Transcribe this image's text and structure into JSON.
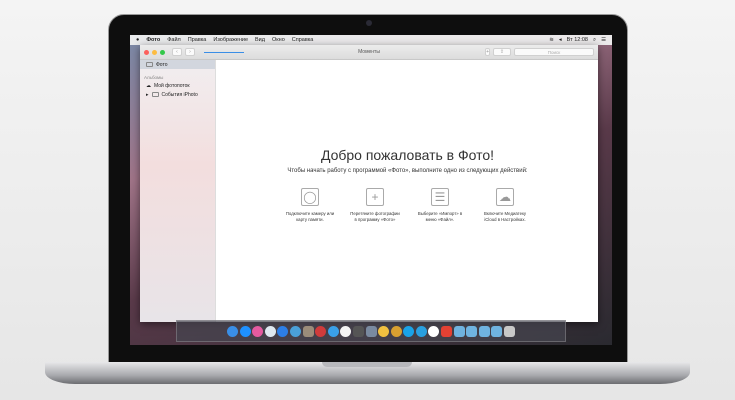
{
  "menubar": {
    "apple": "",
    "app": "Фото",
    "items": [
      "Файл",
      "Правка",
      "Изображение",
      "Вид",
      "Окно",
      "Справка"
    ],
    "clock": "Вт 12:08"
  },
  "window": {
    "title": "Моменты",
    "search_placeholder": "Поиск",
    "add": "+",
    "share": "⇪",
    "back": "‹",
    "forward": "›"
  },
  "sidebar": {
    "photos": "Фото",
    "albums_header": "Альбомы",
    "items": [
      "Мой фотопоток",
      "События iPhoto"
    ]
  },
  "welcome": {
    "title": "Добро пожаловать в Фото!",
    "subtitle": "Чтобы начать работу с программой «Фото», выполните одно из следующих действий:",
    "actions": [
      {
        "icon": "camera-icon",
        "glyph": "◯",
        "text": "Подключите камеру или карту памяти."
      },
      {
        "icon": "plus-stack-icon",
        "glyph": "+",
        "text": "Перетяните фотографии в программу «Фото»"
      },
      {
        "icon": "file-menu-icon",
        "glyph": "☰",
        "text": "Выберите «Импорт» в меню «Файл»."
      },
      {
        "icon": "icloud-icon",
        "glyph": "☁",
        "text": "Включите Медиатеку iCloud в Настройках."
      }
    ]
  },
  "dock": {
    "colors": [
      "#3a8ee6",
      "#1e90ff",
      "#e55aa0",
      "#dfe8f0",
      "#2d7ee6",
      "#4aa0d8",
      "#9b8c7a",
      "#d03b3b",
      "#3aa0e8",
      "#f4f4f4",
      "#555",
      "#7a8aa0",
      "#f0c040",
      "#d9a030",
      "#1aa3e8",
      "#2aa0e0",
      "#fff",
      "#e34133",
      "#6fb3e0",
      "#6fb3e0",
      "#6fb3e0",
      "#6fb3e0",
      "#c8c8c8"
    ]
  }
}
